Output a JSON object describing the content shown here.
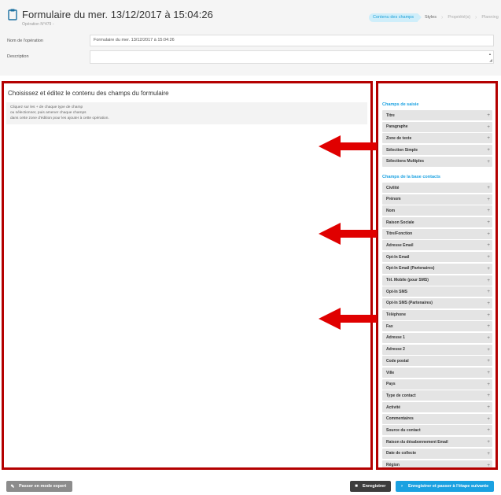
{
  "header": {
    "title": "Formulaire du mer. 13/12/2017 à 15:04:26",
    "operation_number": "Opération N°479 -",
    "steps": [
      "Contenu des champs",
      "Styles",
      "Propriété(s)",
      "Planning"
    ]
  },
  "form": {
    "name_label": "Nom de l'opération",
    "name_value": "Formulaire du mer. 13/12/2017 à 15:04:26",
    "description_label": "Description",
    "description_value": ""
  },
  "editor": {
    "title": "Choisissez et éditez le contenu des champs du formulaire",
    "hint_lines": [
      "Cliquez sur les + de chaque type de champ",
      "ou sélectionner, puis amener chaque champs",
      "dans cette zone d'édition pour les ajouter à cette opération."
    ]
  },
  "palette": {
    "input_fields_title": "Champs de saisie",
    "input_fields": [
      "Titre",
      "Paragraphe",
      "Zone de texte",
      "Sélection Simple",
      "Sélections Multiples"
    ],
    "contact_fields_title": "Champs de la base contacts",
    "contact_fields": [
      "Civilité",
      "Prénom",
      "Nom",
      "Raison Sociale",
      "Titre/Fonction",
      "Adresse Email",
      "Opt-In Email",
      "Opt-In Email (Partenaires)",
      "Tél. Mobile (pour SMS)",
      "Opt-In SMS",
      "Opt-In SMS (Partenaires)",
      "Téléphone",
      "Fax",
      "Adresse 1",
      "Adresse 2",
      "Code postal",
      "Ville",
      "Pays",
      "Type de contact",
      "Activité",
      "Commentaires",
      "Source du contact",
      "Raison du désabonnement Email",
      "Date de collecte",
      "Région"
    ],
    "plus_symbol": "+"
  },
  "footer": {
    "expert_mode": "Passer en mode expert",
    "save": "Enregistrer",
    "save_next": "Enregistrer et passer à l'étape suivante"
  },
  "colors": {
    "highlight_border": "#b40000",
    "arrow": "#e00000",
    "accent": "#1aa1e1"
  }
}
